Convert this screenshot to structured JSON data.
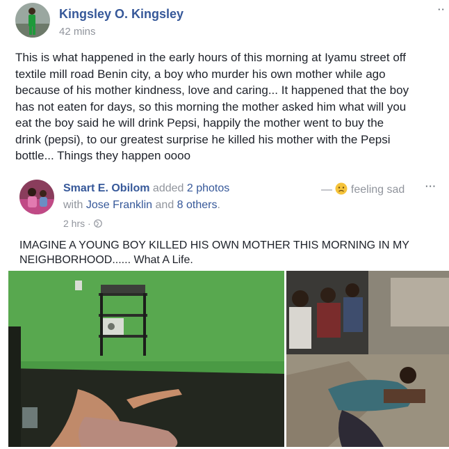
{
  "post": {
    "author": "Kingsley O. Kingsley",
    "time": "42 mins",
    "menu": "··",
    "text": [
      "This is what happened in the early hours of this morning at Iyamu street off",
      "textile mill road Benin city, a boy who murder his own mother while ago",
      "because of his mother kindness, love and caring... It happened that the boy",
      "has not eaten for days, so this morning the mother asked him what will you",
      "eat the boy said he will drink Pepsi, happily the mother went to buy the",
      "drink (pepsi), to our greatest surprise he killed his mother with the Pepsi",
      "bottle... Things they happen oooo"
    ]
  },
  "shared": {
    "author": "Smart E. Obilom",
    "action_prefix": "added",
    "action_count": "2 photos",
    "with_prefix": "with",
    "with_name": "Jose Franklin",
    "with_and": "and",
    "with_others": "8 others",
    "period": ".",
    "feeling_dash": "—",
    "feeling": "feeling sad",
    "menu": "···",
    "time": "2 hrs",
    "separator": "·",
    "caption": [
      "IMAGINE A YOUNG BOY KILLED HIS OWN MOTHER THIS MORNING IN MY",
      "NEIGHBORHOOD...... What A Life."
    ]
  },
  "icons": {
    "feeling": "sad-emoji-icon",
    "privacy": "globe-icon"
  },
  "colors": {
    "link": "#365899",
    "muted": "#90949c",
    "text": "#1d2129",
    "wall_green": "#4a9a44",
    "floor_dark": "#23271f",
    "emoji": "#f5c33b"
  }
}
